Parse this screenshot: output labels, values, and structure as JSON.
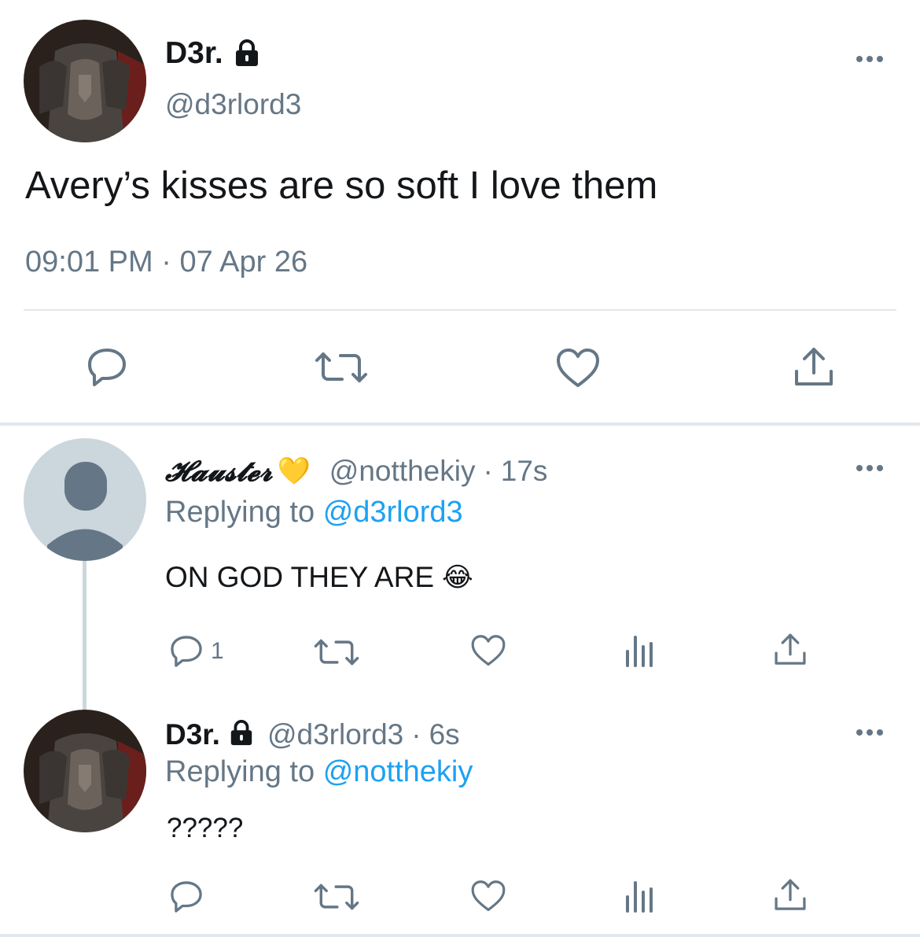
{
  "main_tweet": {
    "display_name": "D3r.",
    "handle": "@d3rlord3",
    "text": "Avery’s kisses are so soft I love them",
    "time": "09:01 PM",
    "separator": "·",
    "date": "07 Apr 26",
    "avatar_icon": "armored-knight-avatar",
    "lock_icon": "lock-icon"
  },
  "reply1": {
    "display_name": "𝓗𝓪𝓾𝓼𝓽𝓮𝓻",
    "emoji": "💛",
    "handle": "@notthekiy",
    "separator": "·",
    "time": "17s",
    "replying_label": "Replying to",
    "replying_to": "@d3rlord3",
    "text": "ON GOD THEY ARE",
    "text_emoji": "😂",
    "reply_count": "1"
  },
  "reply2": {
    "display_name": "D3r.",
    "handle": "@d3rlord3",
    "separator": "·",
    "time": "6s",
    "replying_label": "Replying to",
    "replying_to": "@notthekiy",
    "text": "?????"
  },
  "colors": {
    "text": "#14171a",
    "muted": "#657786",
    "link": "#1da1f2",
    "divider": "#e1e8ed"
  }
}
